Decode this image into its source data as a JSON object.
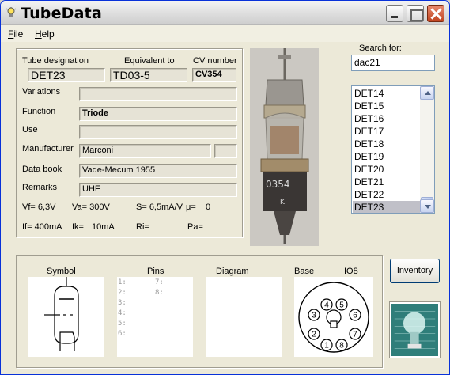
{
  "window": {
    "title": "TubeData"
  },
  "menu": {
    "file": "File",
    "help": "Help"
  },
  "details": {
    "tube_designation_label": "Tube designation",
    "tube_designation": "DET23",
    "equivalent_label": "Equivalent to",
    "equivalent": "TD03-5",
    "cv_label": "CV number",
    "cv": "CV354",
    "variations_label": "Variations",
    "variations": "",
    "function_label": "Function",
    "function": "Triode",
    "use_label": "Use",
    "use": "",
    "manufacturer_label": "Manufacturer",
    "manufacturer": "Marconi",
    "manufacturer_extra": "",
    "databook_label": "Data book",
    "databook": "Vade-Mecum 1955",
    "remarks_label": "Remarks",
    "remarks": "UHF"
  },
  "specs": {
    "vf": "Vf= 6,3V",
    "va": "Va= 300V",
    "s": "S= 6,5mA/V",
    "mu": "μ=",
    "mu_val": "0",
    "if": "If= 400mA",
    "ik": "Ik= ",
    "ik_val": "10mA",
    "ri": "Ri=",
    "pa": "Pa="
  },
  "search": {
    "label": "Search for:",
    "value": "dac21"
  },
  "tube_list": [
    "DET14",
    "DET15",
    "DET16",
    "DET17",
    "DET18",
    "DET19",
    "DET20",
    "DET21",
    "DET22",
    "DET23"
  ],
  "selected_tube": "DET23",
  "lower": {
    "symbol_label": "Symbol",
    "pins_label": "Pins",
    "diagram_label": "Diagram",
    "base_label": "Base",
    "base_type": "IO8",
    "pins_col1": [
      "1:",
      "2:",
      "3:",
      "4:",
      "5:",
      "6:"
    ],
    "pins_col2": [
      "7:",
      "8:"
    ],
    "base_pins": [
      "1",
      "2",
      "3",
      "4",
      "5",
      "6",
      "7",
      "8"
    ]
  },
  "buttons": {
    "inventory": "Inventory"
  },
  "icons": {
    "app": "lightbulb-icon",
    "minimize": "minimize-icon",
    "maximize": "maximize-icon",
    "close": "close-icon",
    "scroll_up": "scroll-up-arrow-icon",
    "scroll_down": "scroll-down-arrow-icon"
  },
  "colors": {
    "title_bar": "#dcdcdc",
    "close_button": "#c0431e",
    "selection": "#c0c0c8",
    "logo_background": "#2f7e7a"
  }
}
